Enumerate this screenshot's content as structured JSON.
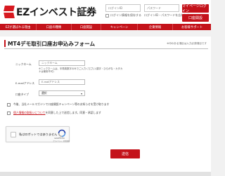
{
  "header": {
    "logo_text": "EZインベスト証券",
    "login_id_placeholder": "ログインID",
    "login_pw_placeholder": "パスワード",
    "save_id_label": "ログイン情報を保存する",
    "forgot_link": "ログインID・パスワードを忘れた方",
    "login_button": "マイページログイン",
    "open_account_button": "口座開設",
    "brand_color": "#c4121a"
  },
  "nav": {
    "items": [
      "EZが選ばれる理由",
      "口座の種類",
      "口座開設",
      "キャンペーン",
      "企業情報",
      "お客様サポート"
    ]
  },
  "form": {
    "title": "MT4デモ取引口座お申込みフォーム",
    "required_note": "※印のある項目は入力必須項目です",
    "nickname_label": "ニックネーム",
    "nickname_placeholder": "ニックネーム",
    "nickname_hint": "※ニックネームは、半角英数字のみでご入力ください(漢字・ひらがな・カタカナは使用不可)",
    "email_label": "E-mailアドレス",
    "email_placeholder": "E-mailアドレス",
    "account_type_label": "口座タイプ",
    "account_type_value": "選択",
    "newsletter_label": "今後、当社メールマガジンで口座開設キャンペーン等のお知らせを受け取ります",
    "privacy_link": "個人情報の取扱いについて",
    "privacy_rest": "を同意した上で送信します。同意・承認します",
    "recaptcha_text": "私はロボットではありません",
    "recaptcha_brand": "reCAPTCHA",
    "recaptcha_terms": "プライバシー - 利用規約",
    "submit_label": "送信"
  }
}
